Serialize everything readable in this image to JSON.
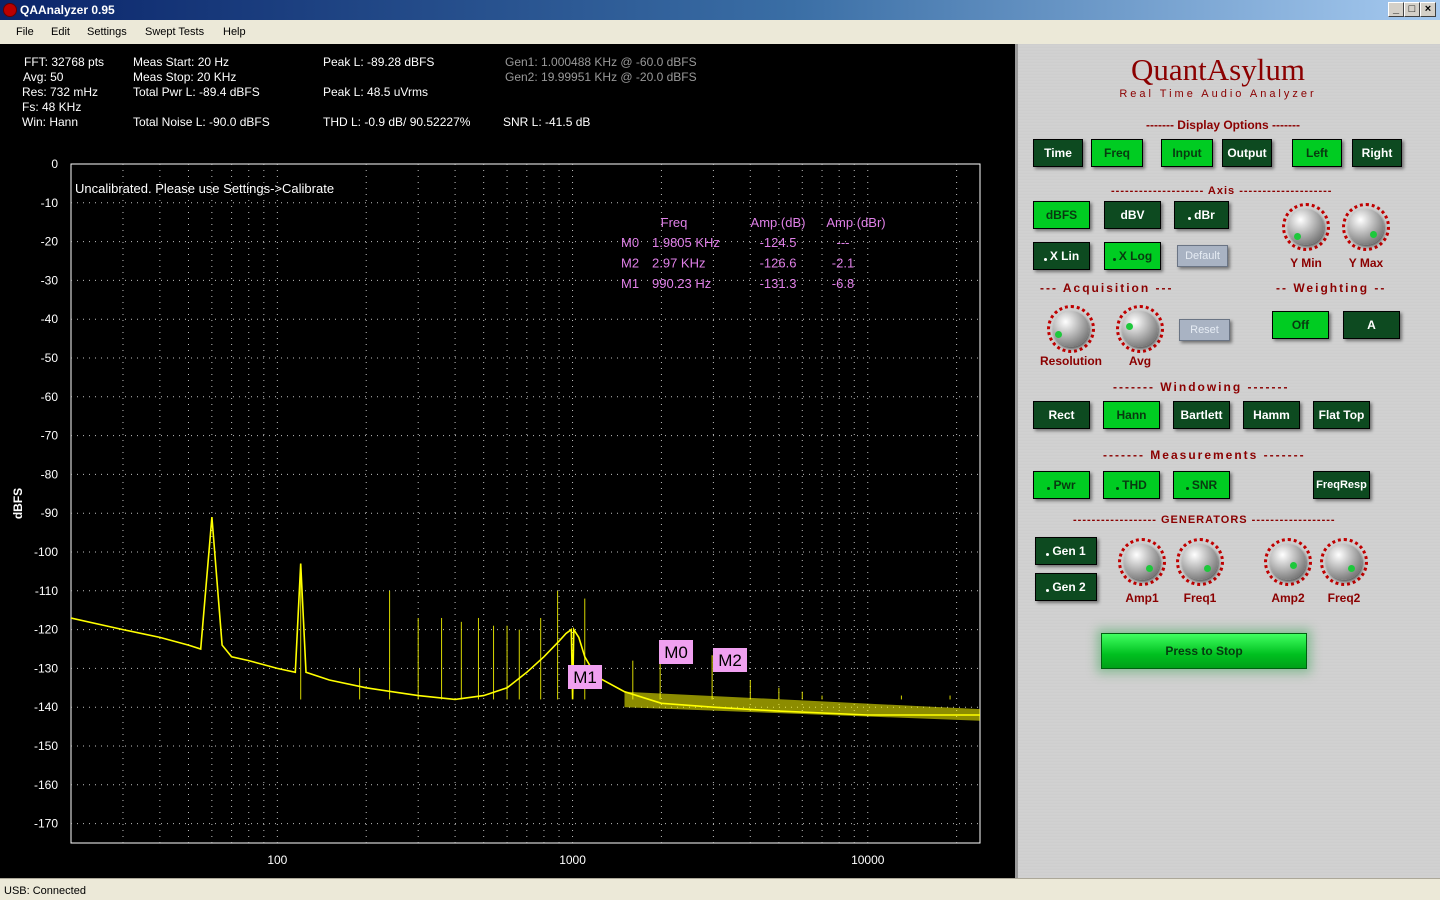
{
  "window": {
    "title": "QAAnalyzer 0.95"
  },
  "menu": {
    "items": [
      "File",
      "Edit",
      "Settings",
      "Swept Tests",
      "Help"
    ]
  },
  "info": {
    "col1": [
      "FFT: 32768 pts",
      "Avg: 50",
      "Res: 732 mHz",
      "Fs: 48 KHz",
      "Win: Hann"
    ],
    "col2": [
      "Meas Start: 20 Hz",
      "Meas Stop: 20 KHz",
      "Total Pwr L: -89.4 dBFS",
      "Total Noise L: -90.0 dBFS"
    ],
    "peak_dbfs": "Peak L: -89.28 dBFS",
    "peak_vrms": "Peak L: 48.5 uVrms",
    "thd": "THD L: -0.9 dB/ 90.52227%",
    "gen1": "Gen1: 1.000488 KHz @ -60.0 dBFS",
    "gen2": "Gen2: 19.99951 KHz @ -20.0 dBFS",
    "snr": "SNR L: -41.5 dB"
  },
  "plot": {
    "calib_msg": "Uncalibrated. Please use Settings->Calibrate",
    "marker_table": {
      "headers": [
        "Freq",
        "Amp (dB)",
        "Amp (dBr)"
      ],
      "rows": [
        {
          "name": "M0",
          "freq": "1.9805 KHz",
          "amp": "-124.5",
          "dbr": "---"
        },
        {
          "name": "M2",
          "freq": "2.97 KHz",
          "amp": "-126.6",
          "dbr": "-2.1"
        },
        {
          "name": "M1",
          "freq": "990.23 Hz",
          "amp": "-131.3",
          "dbr": "-6.8"
        }
      ]
    },
    "markers": [
      {
        "label": "M1",
        "freq": 990.23,
        "amp": -131.3
      },
      {
        "label": "M0",
        "freq": 1980.5,
        "amp": -124.5
      },
      {
        "label": "M2",
        "freq": 2970,
        "amp": -126.6
      }
    ],
    "trace_color": "#ffff00",
    "grid_color": "#c0c0c0"
  },
  "chart_data": {
    "type": "line",
    "title": "",
    "xlabel": "",
    "ylabel": "dBFS",
    "x_scale": "log",
    "xlim": [
      20,
      24000
    ],
    "ylim": [
      -175,
      0
    ],
    "x_ticks": [
      100,
      1000,
      10000
    ],
    "x_tick_labels": [
      "100",
      "1000",
      "10000"
    ],
    "y_ticks": [
      0,
      -10,
      -20,
      -30,
      -40,
      -50,
      -60,
      -70,
      -80,
      -90,
      -100,
      -110,
      -120,
      -130,
      -140,
      -150,
      -160,
      -170
    ],
    "grid": true,
    "series": [
      {
        "name": "",
        "x": [
          20,
          30,
          40,
          50,
          55,
          60,
          65,
          70,
          80,
          100,
          115,
          120,
          125,
          150,
          200,
          300,
          400,
          500,
          600,
          700,
          800,
          900,
          950,
          990,
          1000,
          1010,
          1050,
          1100,
          1200,
          1500,
          2000,
          3000,
          5000,
          10000,
          15000,
          24000
        ],
        "y": [
          -117,
          -120,
          -122,
          -124,
          -125,
          -91,
          -124,
          -127,
          -128,
          -130,
          -131,
          -103,
          -131,
          -133,
          -135,
          -137,
          -138,
          -137,
          -135,
          -131,
          -127,
          -123,
          -121,
          -120,
          -138,
          -120,
          -122,
          -127,
          -132,
          -136,
          -139,
          -140,
          -141,
          -142,
          -142,
          -142
        ]
      }
    ],
    "spurs": [
      {
        "x": 120,
        "y": -103
      },
      {
        "x": 190,
        "y": -130
      },
      {
        "x": 240,
        "y": -110
      },
      {
        "x": 300,
        "y": -117
      },
      {
        "x": 360,
        "y": -117
      },
      {
        "x": 420,
        "y": -118
      },
      {
        "x": 480,
        "y": -117
      },
      {
        "x": 540,
        "y": -119
      },
      {
        "x": 600,
        "y": -119
      },
      {
        "x": 660,
        "y": -120
      },
      {
        "x": 780,
        "y": -117
      },
      {
        "x": 890,
        "y": -110
      },
      {
        "x": 1100,
        "y": -112
      },
      {
        "x": 1600,
        "y": -128
      },
      {
        "x": 1980,
        "y": -124.5
      },
      {
        "x": 2970,
        "y": -126.6
      },
      {
        "x": 4000,
        "y": -133
      },
      {
        "x": 5000,
        "y": -135
      },
      {
        "x": 6000,
        "y": -136
      },
      {
        "x": 7000,
        "y": -137
      },
      {
        "x": 10000,
        "y": -138
      },
      {
        "x": 13000,
        "y": -137
      },
      {
        "x": 19000,
        "y": -137
      }
    ]
  },
  "panel": {
    "brand_title": "QuantAsylum",
    "brand_sub": "Real Time Audio Analyzer",
    "sections": {
      "display": "------- Display Options -------",
      "axis": "-------------------- Axis --------------------",
      "acquisition": "--- Acquisition ---",
      "weighting": "-- Weighting --",
      "windowing": "-------  Windowing  -------",
      "measurements": "-------  Measurements  -------",
      "generators": "------------------ GENERATORS ------------------"
    },
    "buttons": {
      "time": "Time",
      "freq": "Freq",
      "input": "Input",
      "output": "Output",
      "left": "Left",
      "right": "Right",
      "dbfs": "dBFS",
      "dbv": "dBV",
      "dbr": "dBr",
      "xlin": "X Lin",
      "xlog": "X Log",
      "default": "Default",
      "reset": "Reset",
      "w_off": "Off",
      "w_a": "A",
      "rect": "Rect",
      "hann": "Hann",
      "bartlett": "Bartlett",
      "hamm": "Hamm",
      "flattop": "Flat Top",
      "pwr": "Pwr",
      "thd": "THD",
      "snr": "SNR",
      "freqresp": "FreqResp",
      "gen1": "Gen 1",
      "gen2": "Gen 2",
      "stop": "Press to Stop"
    },
    "knobs": {
      "ymin": "Y Min",
      "ymax": "Y Max",
      "resolution": "Resolution",
      "avg": "Avg",
      "amp1": "Amp1",
      "freq1": "Freq1",
      "amp2": "Amp2",
      "freq2": "Freq2"
    },
    "accent_color": "#8b0000",
    "active_color": "#00cc22"
  },
  "status": {
    "text": "USB: Connected"
  }
}
